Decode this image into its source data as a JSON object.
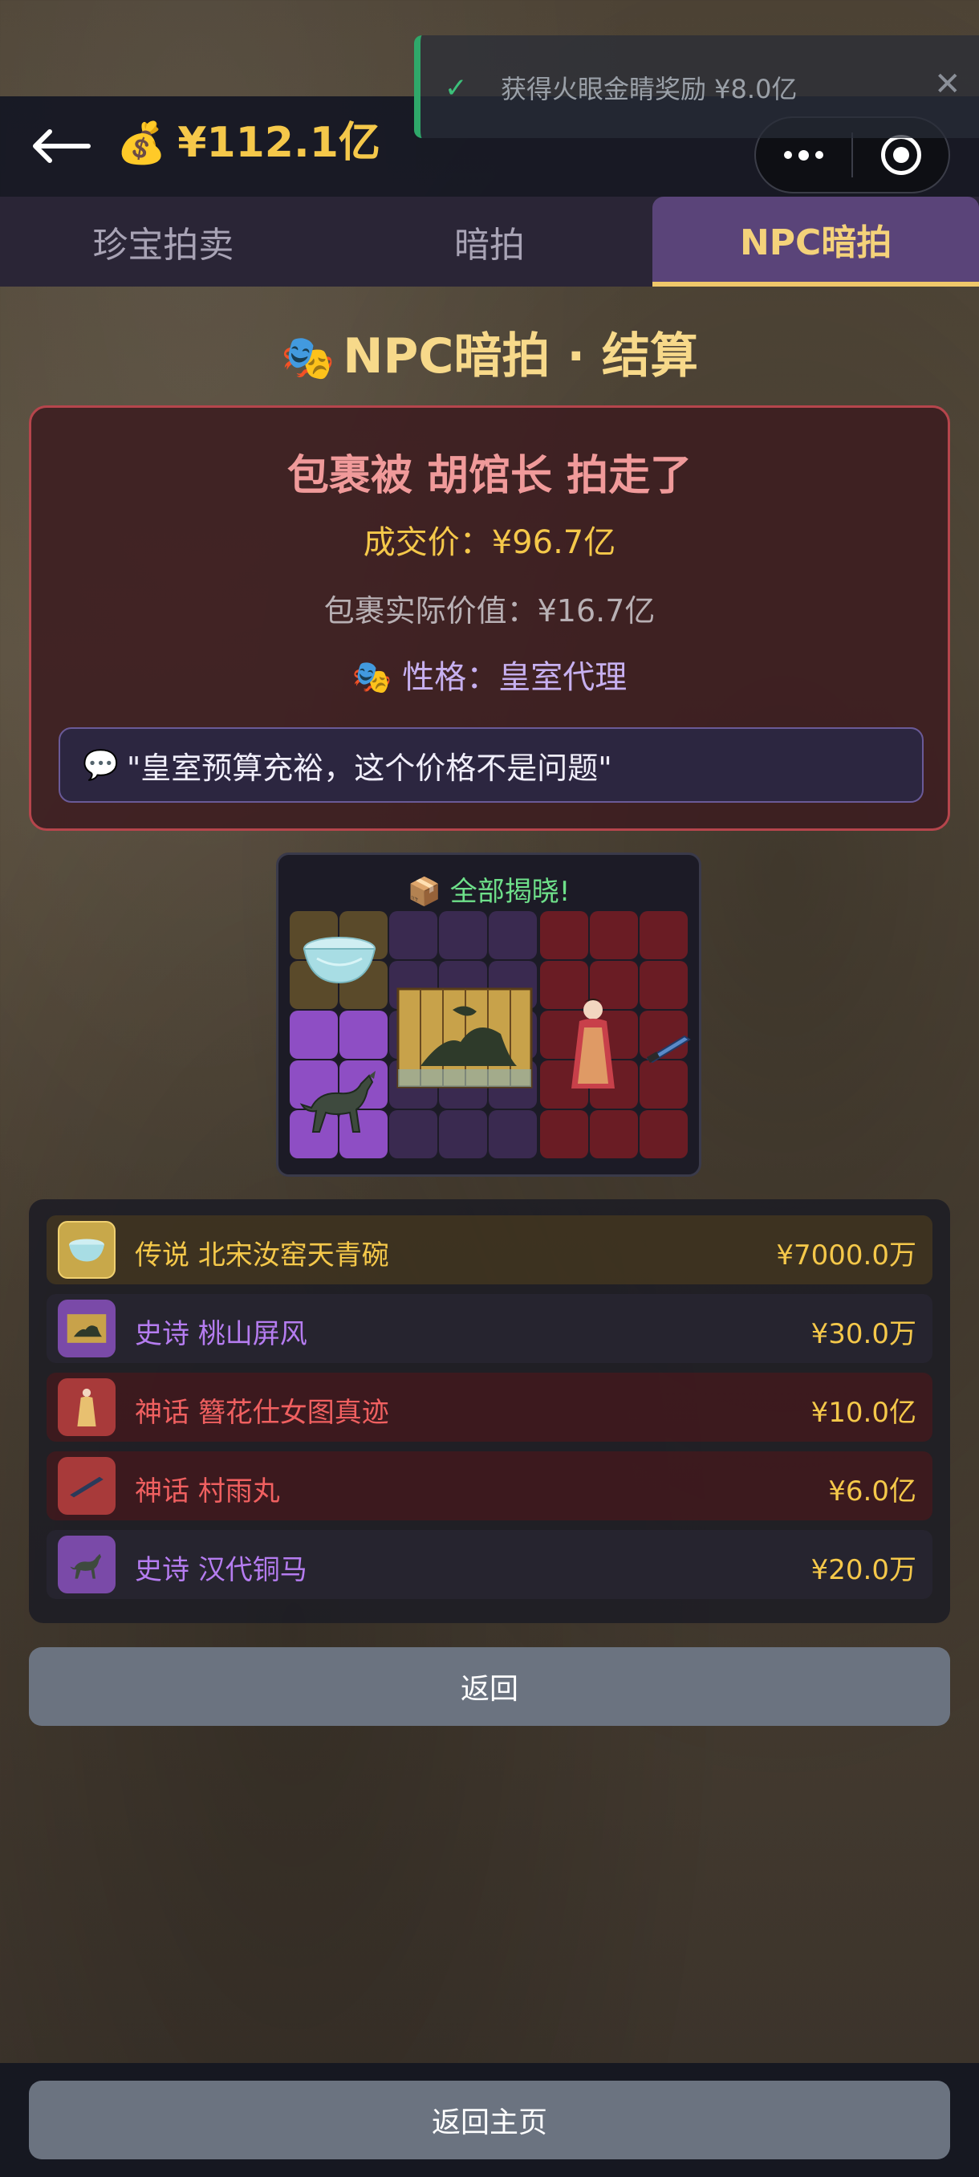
{
  "header": {
    "money": "¥112.1亿",
    "money_icon": "money-bag-icon"
  },
  "toast": {
    "text": "获得火眼金睛奖励 ¥8.0亿"
  },
  "tabs": [
    {
      "label": "珍宝拍卖",
      "active": false
    },
    {
      "label": "暗拍",
      "active": false
    },
    {
      "label": "NPC暗拍",
      "active": true
    }
  ],
  "result": {
    "title": "NPC暗拍 · 结算",
    "headline": "包裹被 胡馆长 拍走了",
    "deal_price": "成交价：¥96.7亿",
    "actual_value": "包裹实际价值：¥16.7亿",
    "persona": "性格：皇室代理",
    "quote": "\"皇室预算充裕，这个价格不是问题\""
  },
  "reveal": {
    "title": "全部揭晓!"
  },
  "items": [
    {
      "rarity": "传说",
      "name": "北宋汝窑天青碗",
      "price": "¥7000.0万",
      "tier": "legend"
    },
    {
      "rarity": "史诗",
      "name": "桃山屏风",
      "price": "¥30.0万",
      "tier": "epic"
    },
    {
      "rarity": "神话",
      "name": "簪花仕女图真迹",
      "price": "¥10.0亿",
      "tier": "myth"
    },
    {
      "rarity": "神话",
      "name": "村雨丸",
      "price": "¥6.0亿",
      "tier": "myth"
    },
    {
      "rarity": "史诗",
      "name": "汉代铜马",
      "price": "¥20.0万",
      "tier": "epic"
    }
  ],
  "buttons": {
    "back": "返回",
    "home": "返回主页"
  },
  "colors": {
    "accent_gold": "#f5c84a",
    "legend": "#f5c84a",
    "epic": "#b57cf0",
    "myth": "#f06060",
    "success": "#3cc07a"
  }
}
